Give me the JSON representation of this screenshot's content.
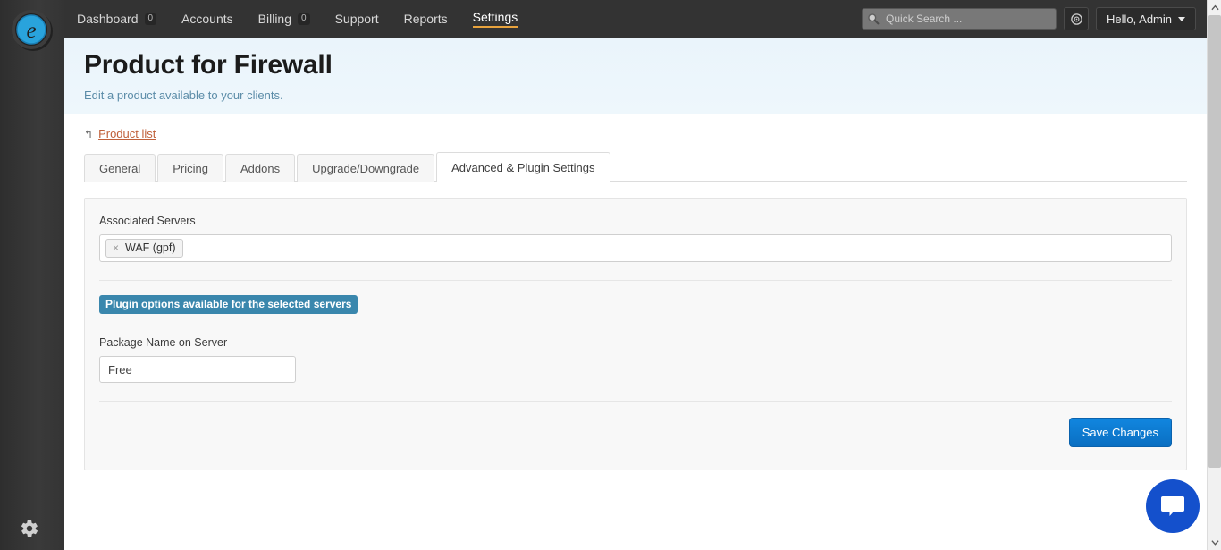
{
  "brand": {
    "logo_letter": "e",
    "logo_color": "#29a3dc",
    "logo_name": "brand-logo"
  },
  "topnav": {
    "items": [
      {
        "label": "Dashboard",
        "badge": "0",
        "active": false
      },
      {
        "label": "Accounts",
        "badge": null,
        "active": false
      },
      {
        "label": "Billing",
        "badge": "0",
        "active": false
      },
      {
        "label": "Support",
        "badge": null,
        "active": false
      },
      {
        "label": "Reports",
        "badge": null,
        "active": false
      },
      {
        "label": "Settings",
        "badge": null,
        "active": true
      }
    ],
    "search": {
      "placeholder": "Quick Search ...",
      "value": "",
      "icon": "search-icon"
    },
    "globe_button_icon": "globe-icon",
    "user_menu": {
      "label": "Hello, Admin",
      "caret": "chevron-down-icon"
    },
    "background_color": "#333333",
    "active_underline_color": "#e8a33d"
  },
  "rail": {
    "gear_icon": "gear-icon"
  },
  "header": {
    "title": "Product for Firewall",
    "subtitle": "Edit a product available to your clients.",
    "background_color": "#eef6fb"
  },
  "breadcrumb": {
    "icon": "level-up-icon",
    "glyph": "↰",
    "link_label": "Product list",
    "link_color": "#c0603a"
  },
  "tabs": [
    {
      "label": "General",
      "active": false
    },
    {
      "label": "Pricing",
      "active": false
    },
    {
      "label": "Addons",
      "active": false
    },
    {
      "label": "Upgrade/Downgrade",
      "active": false
    },
    {
      "label": "Advanced & Plugin Settings",
      "active": true
    }
  ],
  "form": {
    "associated_servers": {
      "label": "Associated Servers",
      "tokens": [
        {
          "label": "WAF (gpf)",
          "remove_glyph": "×"
        }
      ]
    },
    "plugin_badge": {
      "text": "Plugin options available for the selected servers",
      "color": "#3a87ad"
    },
    "package_name": {
      "label": "Package Name on Server",
      "value": "Free",
      "placeholder": ""
    },
    "save_label": "Save Changes",
    "save_color": "#0a6fc2"
  },
  "chat_widget": {
    "icon": "chat-bubble-icon",
    "color": "#1450cc"
  },
  "scrollbar": {
    "up_glyph": "∧",
    "down_glyph": "∨"
  }
}
